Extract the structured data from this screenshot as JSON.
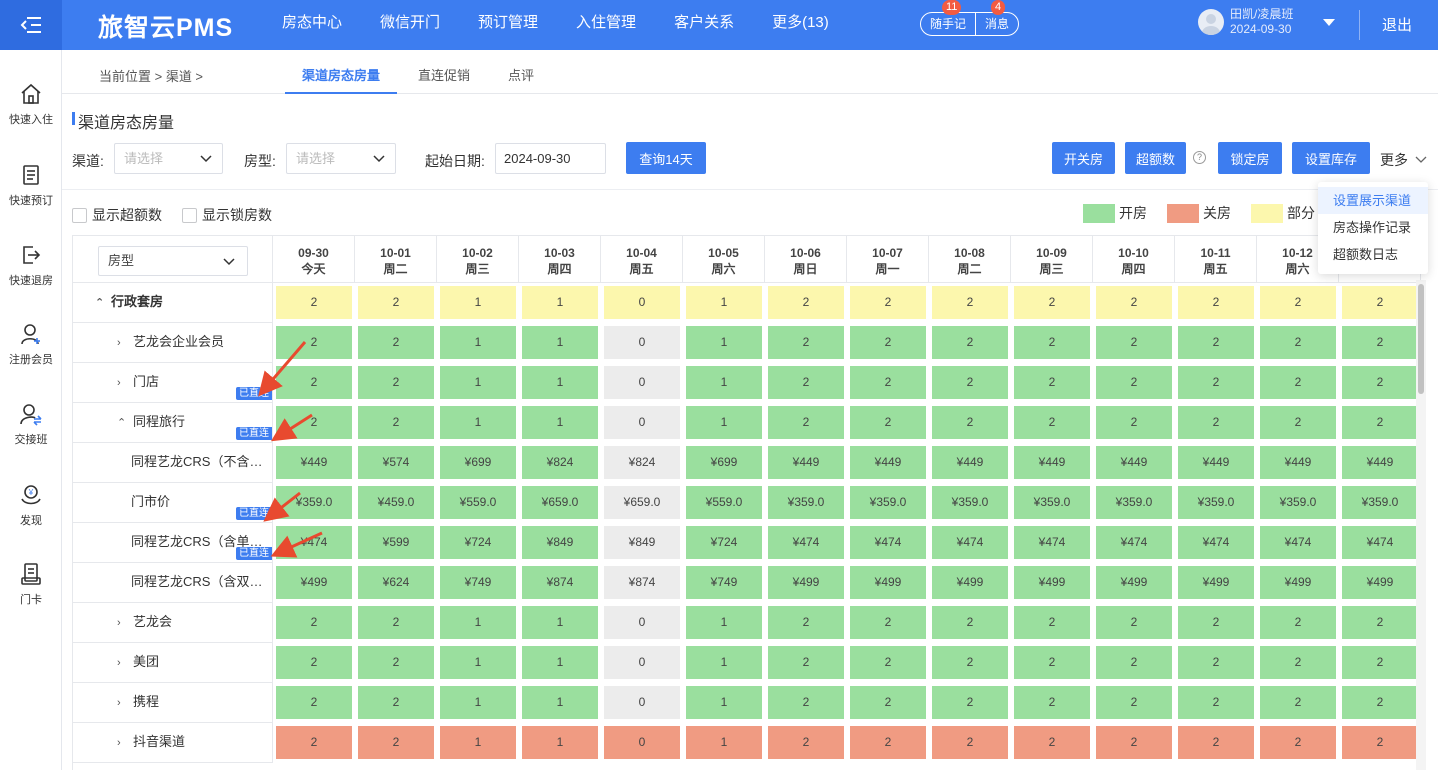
{
  "header": {
    "brand": "旅智云PMS",
    "nav": [
      "房态中心",
      "微信开门",
      "预订管理",
      "入住管理",
      "客户关系",
      "更多(13)"
    ],
    "memo_label": "随手记",
    "memo_badge": "11",
    "message_label": "消息",
    "message_badge": "4",
    "user_name": "田凯/凌晨班",
    "user_date": "2024-09-30",
    "logout": "退出"
  },
  "sidebar": {
    "items": [
      "快速入住",
      "快速预订",
      "快速退房",
      "注册会员",
      "交接班",
      "发现",
      "门卡"
    ]
  },
  "subnav": {
    "breadcrumb": "当前位置 > 渠道 >",
    "tabs": [
      "渠道房态房量",
      "直连促销",
      "点评"
    ]
  },
  "page": {
    "title": "渠道房态房量"
  },
  "filters": {
    "channel_label": "渠道:",
    "channel_placeholder": "请选择",
    "roomtype_label": "房型:",
    "roomtype_placeholder": "请选择",
    "date_label": "起始日期:",
    "date_value": "2024-09-30",
    "query_button": "查询14天"
  },
  "actions": {
    "open_close": "开关房",
    "overbook": "超额数",
    "help": "?",
    "lock": "锁定房",
    "set_stock": "设置库存",
    "more": "更多"
  },
  "checkboxes": {
    "show_overbook": "显示超额数",
    "show_locked": "显示锁房数"
  },
  "legend": {
    "open": "开房",
    "closed": "关房",
    "partial": "部分",
    "colors": {
      "open": "#9adf9e",
      "closed": "#f09b82",
      "partial": "#fcf7ad"
    }
  },
  "more_menu": [
    "设置展示渠道",
    "房态操作记录",
    "超额数日志"
  ],
  "grid": {
    "roomtype_select": "房型",
    "columns": [
      {
        "date": "09-30",
        "day": "今天"
      },
      {
        "date": "10-01",
        "day": "周二"
      },
      {
        "date": "10-02",
        "day": "周三"
      },
      {
        "date": "10-03",
        "day": "周四"
      },
      {
        "date": "10-04",
        "day": "周五"
      },
      {
        "date": "10-05",
        "day": "周六"
      },
      {
        "date": "10-06",
        "day": "周日"
      },
      {
        "date": "10-07",
        "day": "周一"
      },
      {
        "date": "10-08",
        "day": "周二"
      },
      {
        "date": "10-09",
        "day": "周三"
      },
      {
        "date": "10-10",
        "day": "周四"
      },
      {
        "date": "10-11",
        "day": "周五"
      },
      {
        "date": "10-12",
        "day": "周六"
      },
      {
        "date": "",
        "day": ""
      }
    ],
    "rows": [
      {
        "label": "行政套房",
        "arrow": "^",
        "level": 0,
        "bold": true,
        "tag": "",
        "status": "partial",
        "values": [
          "2",
          "2",
          "1",
          "1",
          "0",
          "1",
          "2",
          "2",
          "2",
          "2",
          "2",
          "2",
          "2",
          "2"
        ]
      },
      {
        "label": "艺龙会企业会员",
        "arrow": ">",
        "level": 1,
        "tag": "",
        "status": "open",
        "values": [
          "2",
          "2",
          "1",
          "1",
          "0",
          "1",
          "2",
          "2",
          "2",
          "2",
          "2",
          "2",
          "2",
          "2"
        ]
      },
      {
        "label": "门店",
        "arrow": ">",
        "level": 1,
        "tag": "已直连",
        "status": "open",
        "values": [
          "2",
          "2",
          "1",
          "1",
          "0",
          "1",
          "2",
          "2",
          "2",
          "2",
          "2",
          "2",
          "2",
          "2"
        ]
      },
      {
        "label": "同程旅行",
        "arrow": "^",
        "level": 1,
        "tag": "已直连",
        "status": "open",
        "values": [
          "2",
          "2",
          "1",
          "1",
          "0",
          "1",
          "2",
          "2",
          "2",
          "2",
          "2",
          "2",
          "2",
          "2"
        ]
      },
      {
        "label": "同程艺龙CRS（不含…",
        "arrow": "",
        "level": 2,
        "tag": "",
        "status": "open",
        "values": [
          "¥449",
          "¥574",
          "¥699",
          "¥824",
          "¥824",
          "¥699",
          "¥449",
          "¥449",
          "¥449",
          "¥449",
          "¥449",
          "¥449",
          "¥449",
          "¥449"
        ]
      },
      {
        "label": "门市价",
        "arrow": "",
        "level": 2,
        "tag": "已直连",
        "status": "open",
        "values": [
          "¥359.0",
          "¥459.0",
          "¥559.0",
          "¥659.0",
          "¥659.0",
          "¥559.0",
          "¥359.0",
          "¥359.0",
          "¥359.0",
          "¥359.0",
          "¥359.0",
          "¥359.0",
          "¥359.0",
          "¥359.0"
        ]
      },
      {
        "label": "同程艺龙CRS（含单…",
        "arrow": "",
        "level": 2,
        "tag": "已直连",
        "status": "open",
        "values": [
          "¥474",
          "¥599",
          "¥724",
          "¥849",
          "¥849",
          "¥724",
          "¥474",
          "¥474",
          "¥474",
          "¥474",
          "¥474",
          "¥474",
          "¥474",
          "¥474"
        ]
      },
      {
        "label": "同程艺龙CRS（含双…",
        "arrow": "",
        "level": 2,
        "tag": "",
        "status": "open",
        "values": [
          "¥499",
          "¥624",
          "¥749",
          "¥874",
          "¥874",
          "¥749",
          "¥499",
          "¥499",
          "¥499",
          "¥499",
          "¥499",
          "¥499",
          "¥499",
          "¥499"
        ]
      },
      {
        "label": "艺龙会",
        "arrow": ">",
        "level": 1,
        "tag": "",
        "status": "open",
        "values": [
          "2",
          "2",
          "1",
          "1",
          "0",
          "1",
          "2",
          "2",
          "2",
          "2",
          "2",
          "2",
          "2",
          "2"
        ]
      },
      {
        "label": "美团",
        "arrow": ">",
        "level": 1,
        "tag": "",
        "status": "open",
        "values": [
          "2",
          "2",
          "1",
          "1",
          "0",
          "1",
          "2",
          "2",
          "2",
          "2",
          "2",
          "2",
          "2",
          "2"
        ]
      },
      {
        "label": "携程",
        "arrow": ">",
        "level": 1,
        "tag": "",
        "status": "open",
        "values": [
          "2",
          "2",
          "1",
          "1",
          "0",
          "1",
          "2",
          "2",
          "2",
          "2",
          "2",
          "2",
          "2",
          "2"
        ]
      },
      {
        "label": "抖音渠道",
        "arrow": ">",
        "level": 1,
        "tag": "",
        "status": "closed",
        "values": [
          "2",
          "2",
          "1",
          "1",
          "0",
          "1",
          "2",
          "2",
          "2",
          "2",
          "2",
          "2",
          "2",
          "2"
        ]
      }
    ]
  }
}
